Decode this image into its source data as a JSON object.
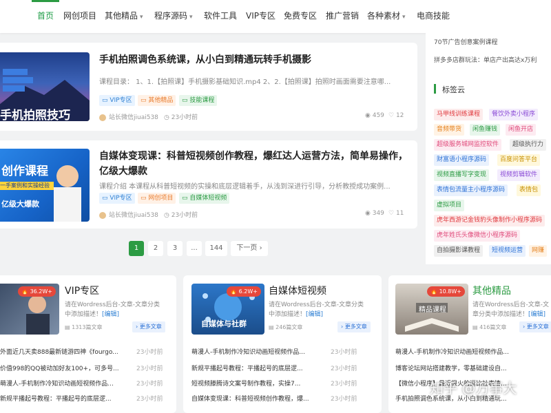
{
  "nav": {
    "items": [
      "首页",
      "网创项目",
      "其他精品",
      "程序源码",
      "软件工具",
      "VIP专区",
      "免费专区",
      "推广营销",
      "各种素材",
      "电商技能"
    ],
    "dropdown": [
      "",
      "",
      "▾",
      "▾",
      "",
      "",
      "",
      "",
      "▾",
      ""
    ]
  },
  "posts": [
    {
      "title": "手机拍照调色系统课，从小白到精通玩转手机摄影",
      "desc": "课程目录： 1、1.【拍照课】手机摄影基础知识.mp4 2、2.【拍照课】拍照时画面需要注意哪...",
      "tags": [
        "VIP专区",
        "其他精品",
        "技能课程"
      ],
      "author": "站长微信jiuai538",
      "time": "23小时前",
      "views": "459",
      "likes": "12",
      "thumb_text": "手机拍照技巧"
    },
    {
      "title": "自媒体变现课：科普短视频创作教程，爆红达人运营方法，简单易操作，亿级大爆款",
      "desc": "课程介绍 本课程从科普短视频的实操和底层逻辑着手，从浅到深进行引导，分析教授成功案例...",
      "tags": [
        "VIP专区",
        "网创项目",
        "自媒体短视频"
      ],
      "author": "站长微信jiuai538",
      "time": "23小时前",
      "views": "349",
      "likes": "11",
      "thumb_text": "创作课程",
      "thumb_sub": "一手案例和实操经验",
      "thumb_sub2": "亿级大爆款"
    }
  ],
  "pagination": [
    "1",
    "2",
    "3",
    "...",
    "144",
    "下一页 ›"
  ],
  "sidebar": {
    "lines": [
      "70节广告创意案例课程",
      "拼多多店群玩法：单店产出高达x万利"
    ],
    "cloud_title": "标签云",
    "tags": [
      "马甲线训练课程",
      "餐饮外卖小程序",
      "音频带货",
      "闲鱼赚钱",
      "闲鱼开店",
      "超级服务城网监控软件",
      "超级执行力",
      "财富语小程序源码",
      "百度问答平台",
      "视频直播写字变现",
      "视频剪辑软件",
      "表情包流量主小程序源码",
      "表情包",
      "虚拟项目",
      "虎年西游记金钱豹头像制作小程序源码",
      "虎年姓氏头像微信小程序源码",
      "自拍摄影课教程",
      "短视频运营",
      "网赚"
    ]
  },
  "bottom": [
    {
      "title": "VIP专区",
      "views": "36.2W+",
      "desc": "请在Wordress后台-文章-文章分类中添加描述！",
      "edit": "[编辑]",
      "count": "1313篇文章",
      "more": "› 更多文章",
      "rows": [
        "外面近几天卖888最新链游四神《fourgo...",
        "价值998的QQ被动加好友100+，可多号...",
        "萌漫人-手机制作冷知识动画短视频作品...",
        "新规平播起号教程：平播起号的底层逻..."
      ],
      "times": [
        "23小时前",
        "23小时前",
        "23小时前",
        "23小时前"
      ]
    },
    {
      "title": "自媒体短视频",
      "views": "6.2W+",
      "desc": "请在Wordress后台-文章-文章分类中添加描述！",
      "edit": "[编辑]",
      "count": "246篇文章",
      "more": "› 更多文章",
      "thumb_text": "自媒体与社群",
      "rows": [
        "萌漫人-手机制作冷知识动画短视频作品...",
        "新规平播起号教程：平播起号的底层逻...",
        "短视频滕腾诗文案号制作教程，实操7...",
        "自媒体变现课：科普短视频创作教程，爆..."
      ],
      "times": [
        "23小时前",
        "23小时前",
        "23小时前",
        "23小时前"
      ]
    },
    {
      "title": "其他精品",
      "views": "10.8W+",
      "desc": "请在Wordress后台-文章-文章分类中添加描述！",
      "edit": "[编辑]",
      "count": "416篇文章",
      "more": "› 更多文章",
      "thumb_text": "精品课程",
      "rows": [
        "萌漫人-手机制作冷知识动画短视频作品...",
        "博客论坛网站搭建教学，零基础建设自...",
        "【微信小程序】最近很火的逗比社表情...",
        "手机拍照调色系统课，从小白到精通玩..."
      ],
      "times": [
        "",
        "",
        "",
        ""
      ]
    }
  ],
  "watermark": "知乎 @万事大"
}
